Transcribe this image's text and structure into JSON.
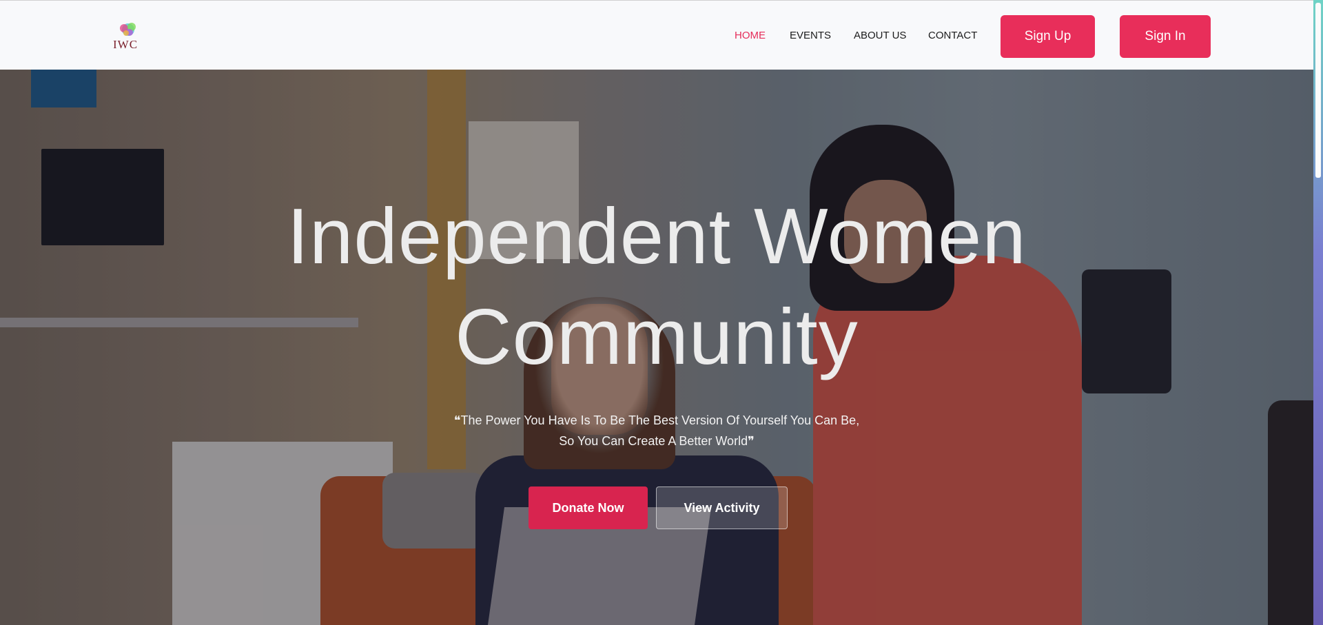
{
  "header": {
    "logo_text": "IWC",
    "nav": [
      {
        "label": "HOME",
        "active": true
      },
      {
        "label": "EVENTS",
        "active": false
      },
      {
        "label": "ABOUT US",
        "active": false
      },
      {
        "label": "CONTACT",
        "active": false
      }
    ],
    "signup_label": "Sign Up",
    "signin_label": "Sign In"
  },
  "hero": {
    "title_line1": "Independent Women",
    "title_line2": "Community",
    "quote": "❝The Power You Have Is To Be The Best Version Of Yourself You Can Be, So You Can Create A Better World❞",
    "donate_label": "Donate Now",
    "view_activity_label": "View Activity"
  },
  "colors": {
    "accent": "#e82e5a",
    "active_nav": "#e52d5a",
    "header_bg": "#f8f9fb"
  }
}
